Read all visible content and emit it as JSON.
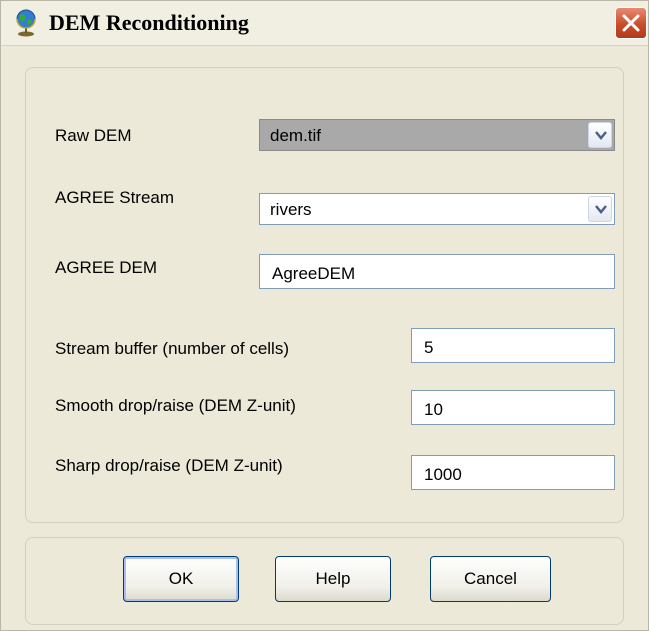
{
  "window": {
    "title": "DEM Reconditioning",
    "icon": "globe-icon",
    "close_icon": "close-icon"
  },
  "form": {
    "raw_dem": {
      "label": "Raw DEM",
      "value": "dem.tif"
    },
    "agree_stream": {
      "label": "AGREE Stream",
      "value": "rivers"
    },
    "agree_dem": {
      "label": "AGREE DEM",
      "value": "AgreeDEM"
    },
    "stream_buffer": {
      "label": "Stream buffer (number of cells)",
      "value": "5"
    },
    "smooth_drop": {
      "label": "Smooth drop/raise (DEM Z-unit)",
      "value": "10"
    },
    "sharp_drop": {
      "label": "Sharp drop/raise (DEM Z-unit)",
      "value": "1000"
    }
  },
  "buttons": {
    "ok": "OK",
    "help": "Help",
    "cancel": "Cancel"
  },
  "colors": {
    "dialog_bg": "#ece9d8",
    "close_button": "#c84d2b",
    "input_border": "#7f9db9",
    "button_border": "#003c74"
  }
}
